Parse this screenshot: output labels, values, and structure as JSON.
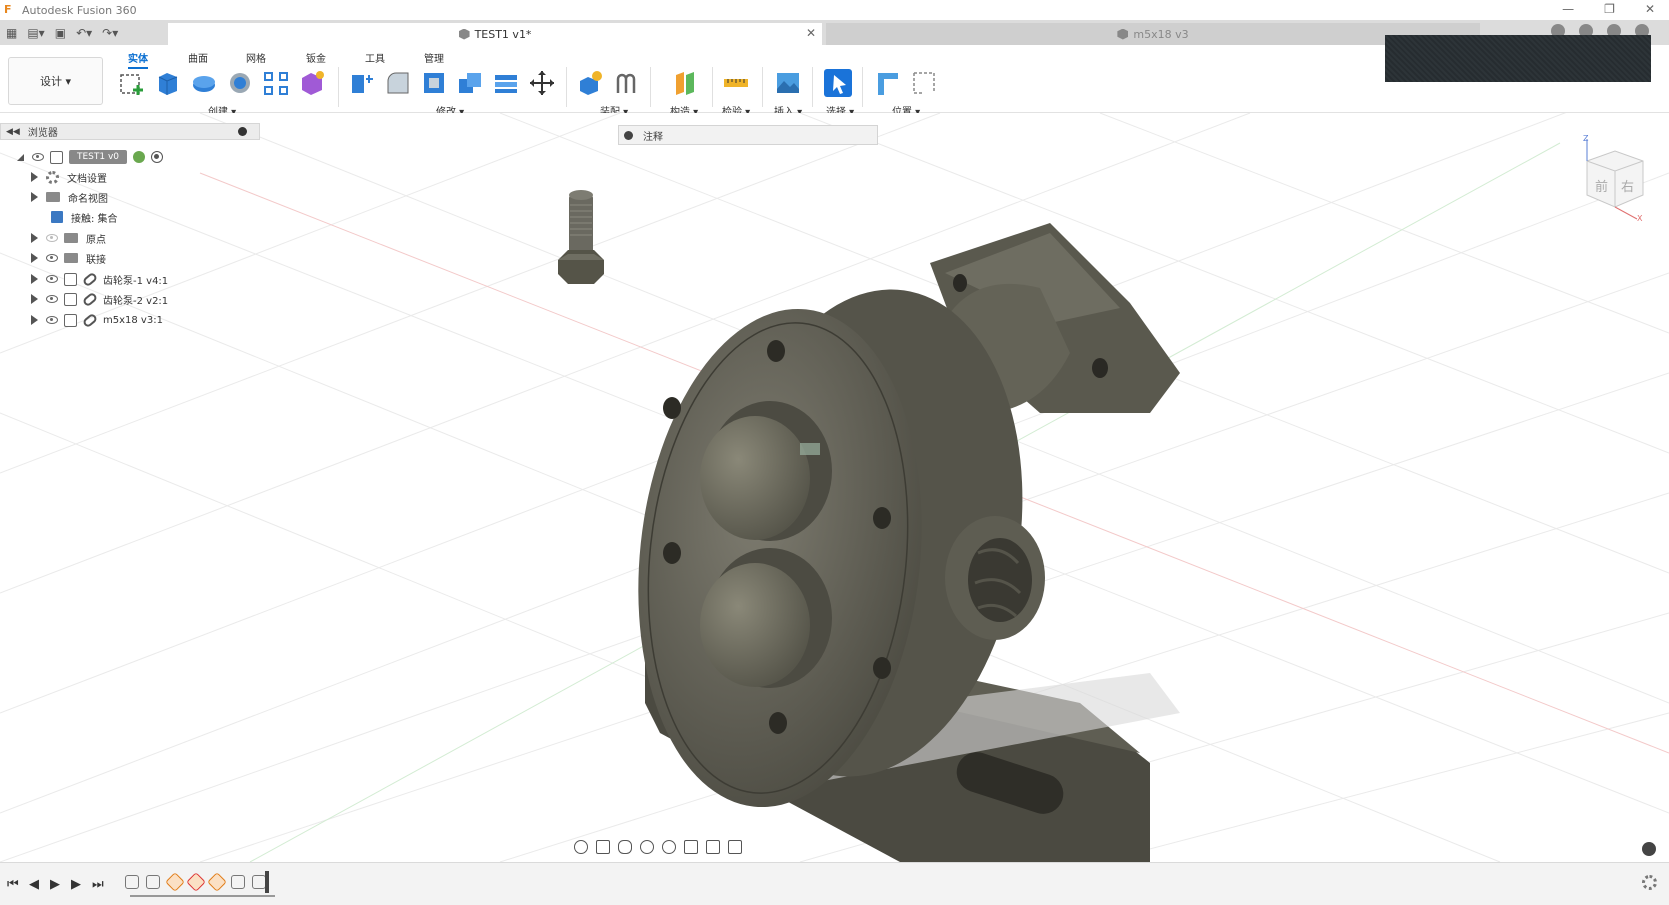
{
  "app": {
    "title": "Autodesk Fusion 360",
    "window_controls": [
      "—",
      "❐",
      "✕"
    ]
  },
  "tabs": {
    "active": {
      "label": "TEST1 v1*",
      "close": "✕"
    },
    "inactive": {
      "label": "m5x18 v3"
    }
  },
  "ribbon": {
    "workspace": "设计 ▾",
    "tabs": [
      "实体",
      "曲面",
      "网格",
      "钣金",
      "工具",
      "管理"
    ],
    "groups": {
      "create": "创建 ▾",
      "modify": "修改 ▾",
      "assemble": "装配 ▾",
      "construct": "构造 ▾",
      "inspect": "检验 ▾",
      "insert": "插入 ▾",
      "select": "选择 ▾",
      "position": "位置 ▾"
    }
  },
  "browser": {
    "title": "浏览器",
    "collapse": "◀◀",
    "root": "TEST1 v0",
    "items": [
      {
        "label": "文档设置"
      },
      {
        "label": "命名视图"
      },
      {
        "label": "接触: 集合"
      },
      {
        "label": "原点"
      },
      {
        "label": "联接"
      },
      {
        "label": "齿轮泵-1 v4:1"
      },
      {
        "label": "齿轮泵-2 v2:1"
      },
      {
        "label": "m5x18 v3:1"
      }
    ]
  },
  "annotation_panel": {
    "label": "注释"
  },
  "viewcube": {
    "front": "前",
    "right": "右",
    "axis_z": "Z",
    "axis_x": "X"
  },
  "timeline": {
    "controls": [
      "⏮",
      "◀",
      "▶",
      "▶",
      "⏭"
    ]
  },
  "colors": {
    "accent": "#0b6fd1",
    "part": "#59574c",
    "part_light": "#7a786c",
    "grid": "#e4e4e4"
  }
}
